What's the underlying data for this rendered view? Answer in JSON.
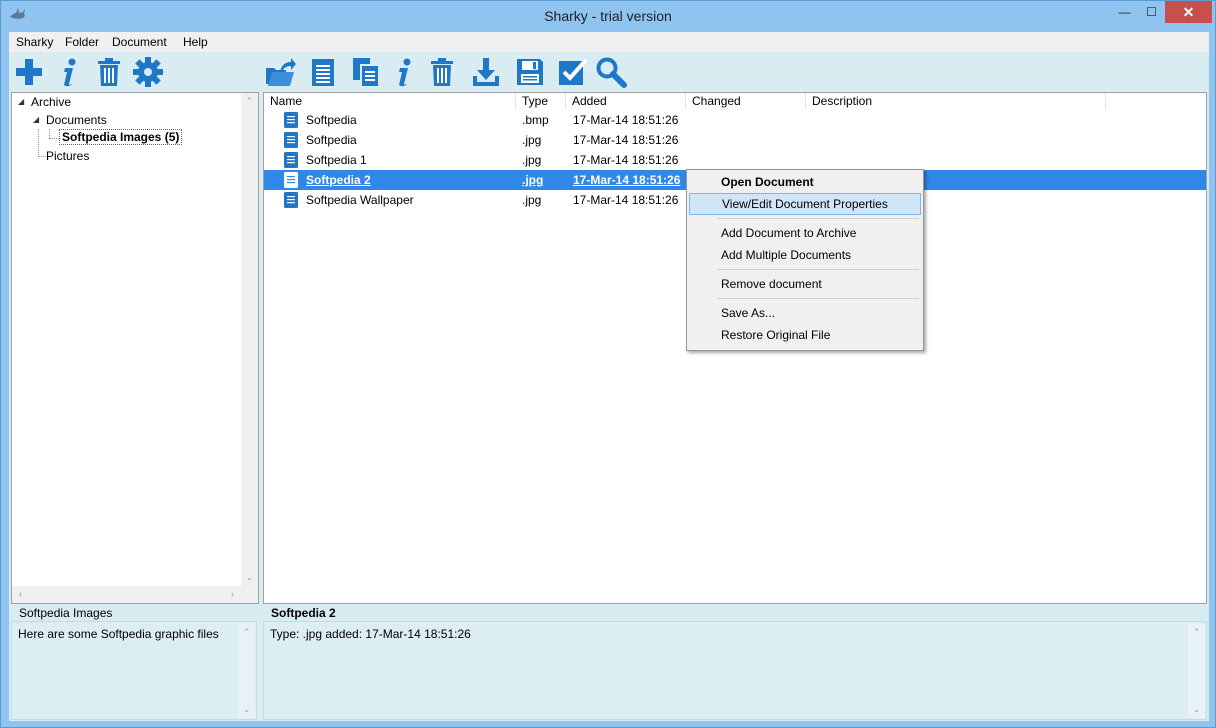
{
  "window": {
    "title": "Sharky - trial version",
    "min_glyph": "—",
    "max_glyph": "☐",
    "close_glyph": "✕"
  },
  "menu": [
    "Sharky",
    "Folder",
    "Document",
    "Help"
  ],
  "toolbar": {
    "left_icons": [
      "add-icon",
      "info-icon",
      "trash-icon",
      "settings-icon"
    ],
    "right_icons": [
      "open-folder-icon",
      "document-icon",
      "copy-documents-icon",
      "info-icon",
      "trash-icon",
      "download-icon",
      "save-icon",
      "checkbox-icon",
      "search-icon"
    ]
  },
  "tree": {
    "root": "Archive",
    "documents": "Documents",
    "selected_folder": "Softpedia Images (5)",
    "pictures": "Pictures"
  },
  "list": {
    "columns": [
      "Name",
      "Type",
      "Added",
      "Changed",
      "Description"
    ],
    "rows": [
      {
        "name": "Softpedia",
        "type": ".bmp",
        "added": "17-Mar-14 18:51:26",
        "changed": "",
        "description": ""
      },
      {
        "name": "Softpedia",
        "type": ".jpg",
        "added": "17-Mar-14 18:51:26",
        "changed": "",
        "description": ""
      },
      {
        "name": "Softpedia 1",
        "type": ".jpg",
        "added": "17-Mar-14 18:51:26",
        "changed": "",
        "description": ""
      },
      {
        "name": "Softpedia 2",
        "type": ".jpg",
        "added": "17-Mar-14 18:51:26",
        "changed": "",
        "description": ""
      },
      {
        "name": "Softpedia Wallpaper",
        "type": ".jpg",
        "added": "17-Mar-14 18:51:26",
        "changed": "",
        "description": ""
      }
    ],
    "selected_index": 3
  },
  "context_menu": {
    "open": "Open Document",
    "view_edit": "View/Edit Document Properties",
    "add_to_archive": "Add Document to Archive",
    "add_multiple": "Add Multiple Documents",
    "remove": "Remove document",
    "save_as": "Save As...",
    "restore": "Restore Original File"
  },
  "bottom_left": {
    "title": "Softpedia Images",
    "text": "Here are some Softpedia graphic files"
  },
  "bottom_right": {
    "title": "Softpedia 2",
    "text": "Type: .jpg added: 17-Mar-14 18:51:26"
  },
  "colors": {
    "accent": "#2f87e8",
    "icon_blue": "#1f77c8",
    "frame": "#8fc3f0",
    "close_red": "#c7504b"
  }
}
